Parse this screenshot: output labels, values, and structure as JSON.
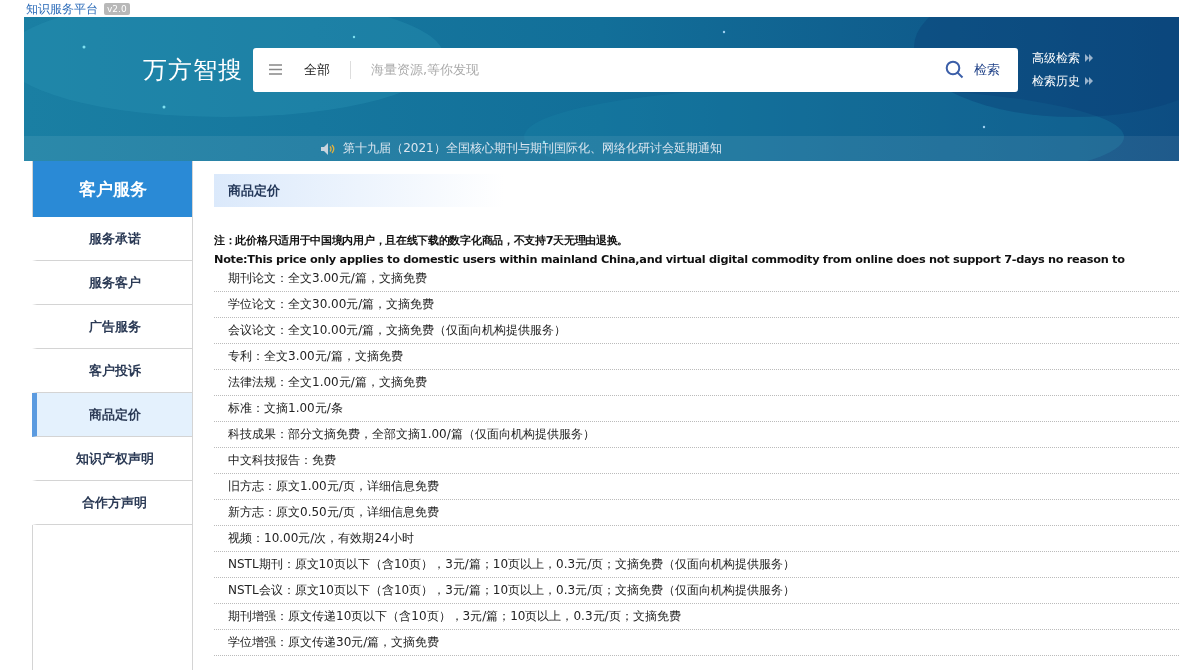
{
  "site": {
    "title": "知识服务平台",
    "version": "v2.0"
  },
  "banner": {
    "kind": "picture",
    "brand": "万方智搜",
    "search": {
      "category": "全部",
      "placeholder": "海量资源,等你发现",
      "button": "检索"
    },
    "links": [
      "高级检索",
      "检索历史"
    ],
    "notice": "第十九届（2021）全国核心期刊与期刊国际化、网络化研讨会延期通知"
  },
  "sidebar": {
    "title": "客户服务",
    "items": [
      {
        "label": "服务承诺",
        "selected": false
      },
      {
        "label": "服务客户",
        "selected": false
      },
      {
        "label": "广告服务",
        "selected": false
      },
      {
        "label": "客户投诉",
        "selected": false
      },
      {
        "label": "商品定价",
        "selected": true
      },
      {
        "label": "知识产权声明",
        "selected": false
      },
      {
        "label": "合作方声明",
        "selected": false
      }
    ]
  },
  "content": {
    "title": "商品定价",
    "notes": [
      "注：此价格只适用于中国境内用户，且在线下载的数字化商品，不支持7天无理由退换。",
      "Note:This price only applies to domestic users within mainland China,and virtual digital commodity from online does not support 7-days no reason to"
    ],
    "prices": [
      "期刊论文：全文3.00元/篇，文摘免费",
      "学位论文：全文30.00元/篇，文摘免费",
      "会议论文：全文10.00元/篇，文摘免费（仅面向机构提供服务）",
      "专利：全文3.00元/篇，文摘免费",
      "法律法规：全文1.00元/篇，文摘免费",
      "标准：文摘1.00元/条",
      "科技成果：部分文摘免费，全部文摘1.00/篇（仅面向机构提供服务）",
      "中文科技报告：免费",
      "旧方志：原文1.00元/页，详细信息免费",
      "新方志：原文0.50元/页，详细信息免费",
      "视频：10.00元/次，有效期24小时",
      "NSTL期刊：原文10页以下（含10页），3元/篇；10页以上，0.3元/页；文摘免费（仅面向机构提供服务）",
      "NSTL会议：原文10页以下（含10页），3元/篇；10页以上，0.3元/页；文摘免费（仅面向机构提供服务）",
      "期刊增强：原文传递10页以下（含10页），3元/篇；10页以上，0.3元/页；文摘免费",
      "学位增强：原文传递30元/篇，文摘免费"
    ]
  }
}
